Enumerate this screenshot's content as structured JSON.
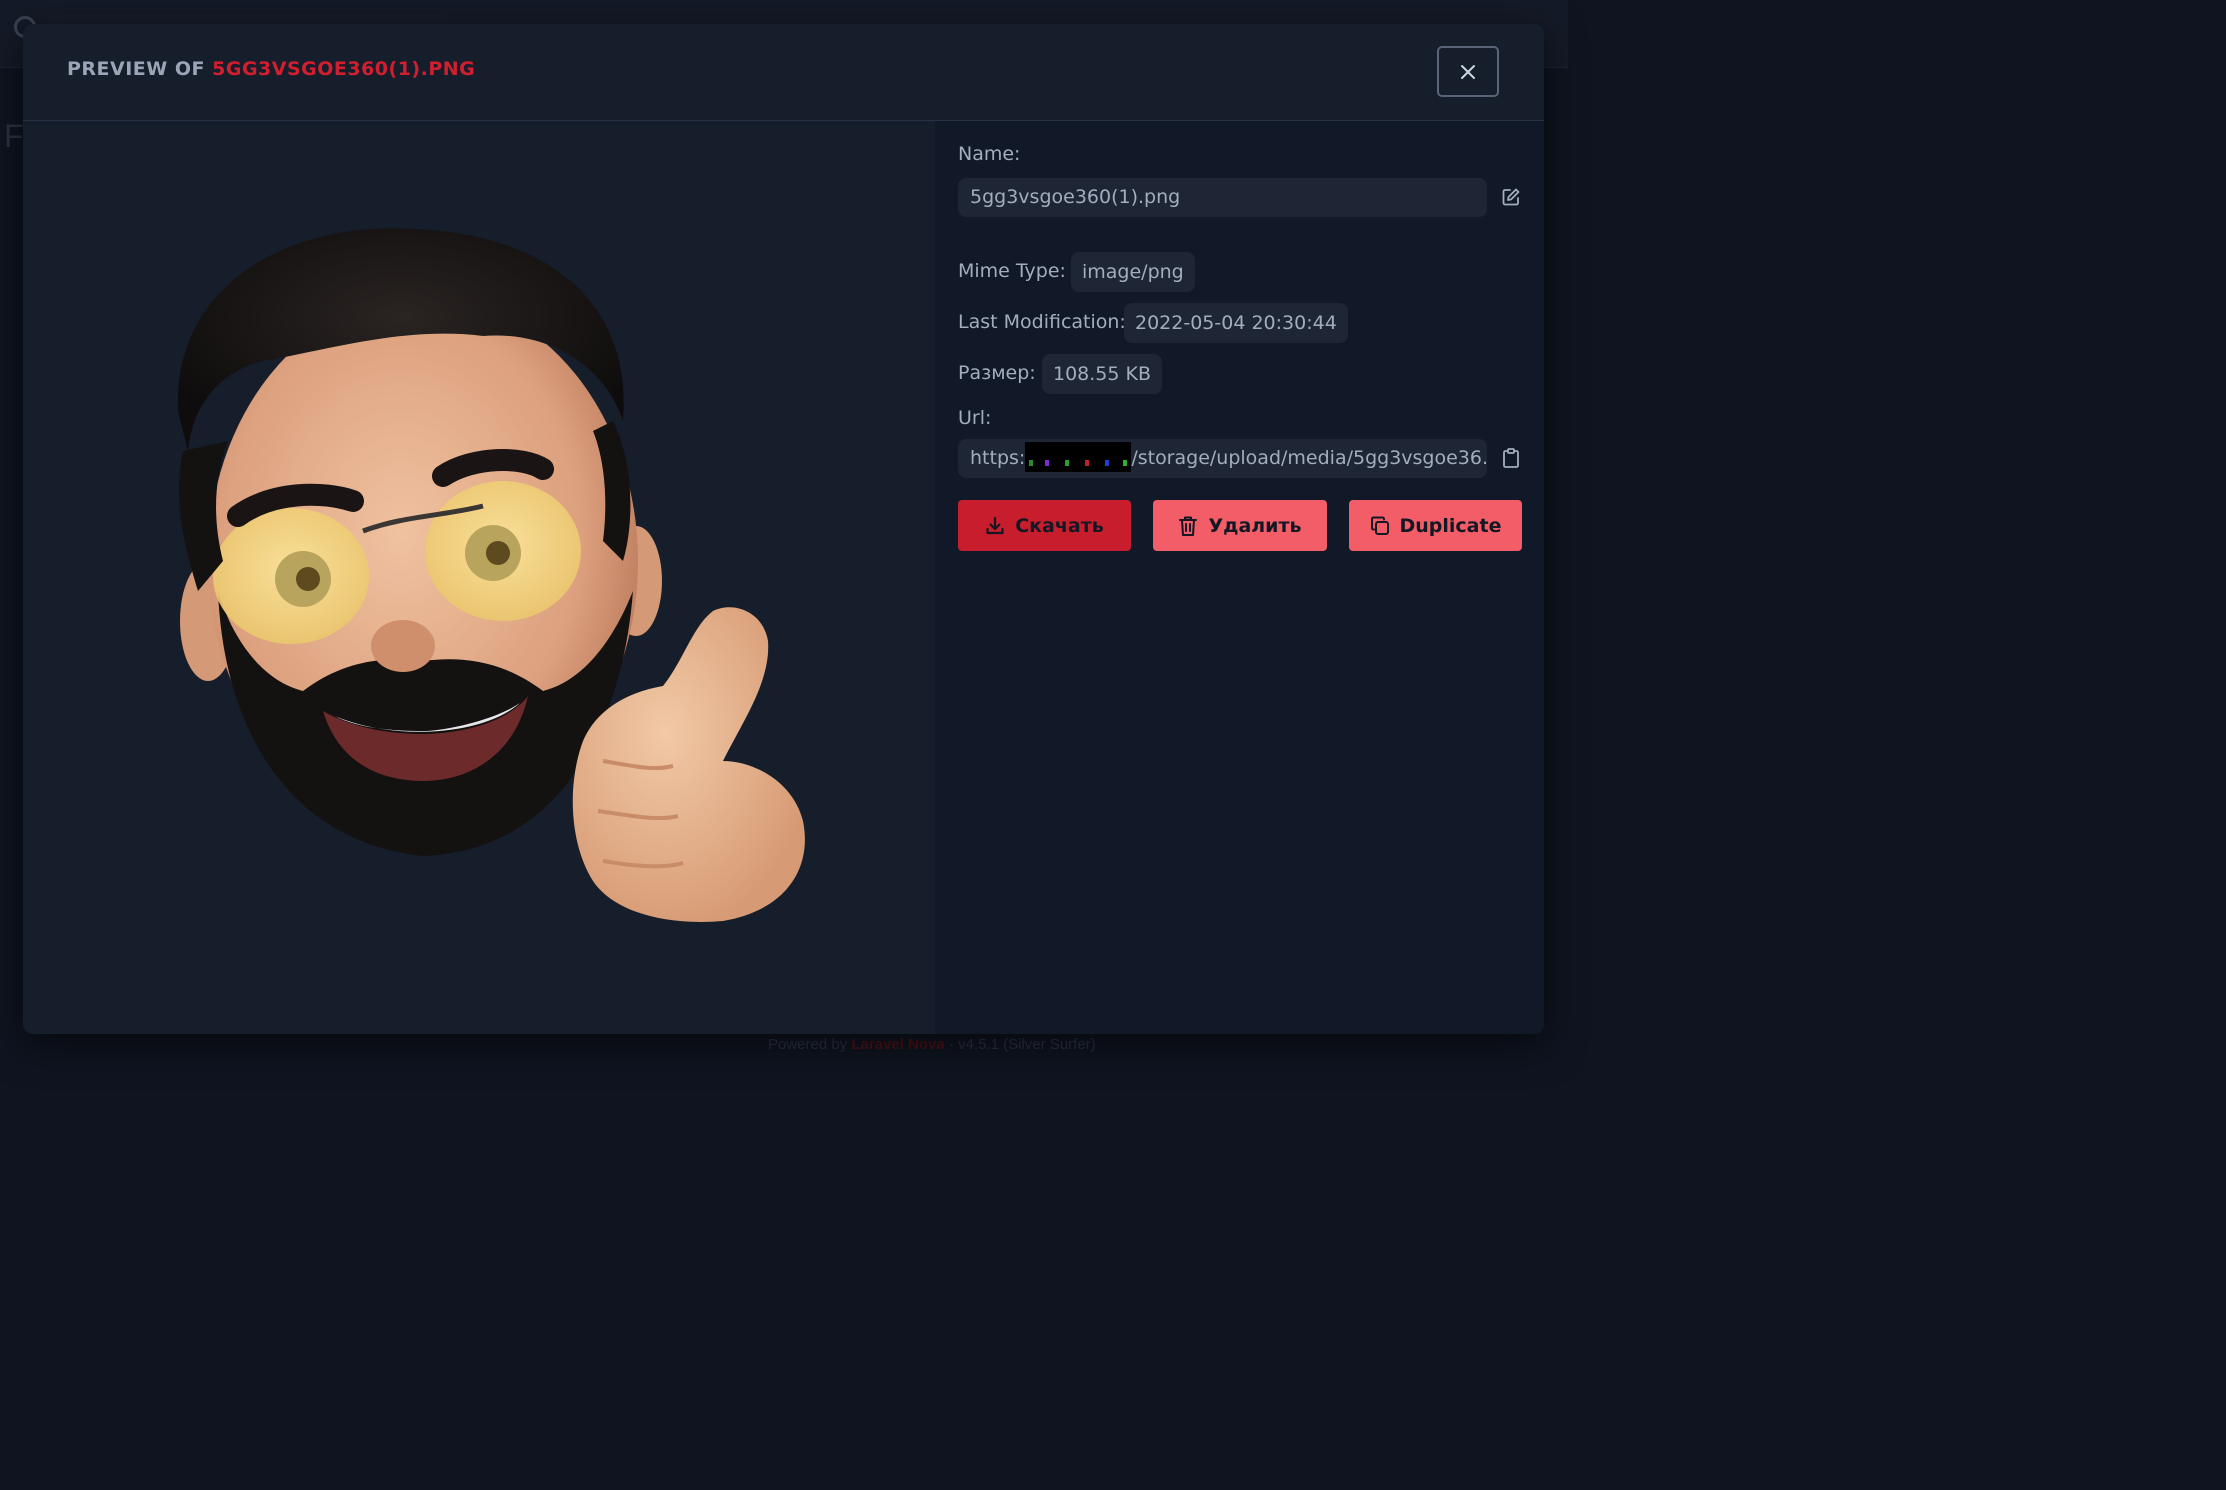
{
  "background": {
    "page_letter": "F",
    "footer": {
      "prefix": "Powered by",
      "brand": "Laravel Nova",
      "version": "· v4.5.1 (Silver Surfer)"
    }
  },
  "modal": {
    "title_prefix": "Preview of",
    "file_name_title": "5gg3vsgoe360(1).png",
    "close_icon": "close-icon",
    "preview": {
      "image_alt": "Memoji avatar: bearded man with sunglasses giving thumbs up"
    },
    "details": {
      "name_label": "Name:",
      "name_value": "5gg3vsgoe360(1).png",
      "mime_label": "Mime Type:",
      "mime_value": "image/png",
      "modified_label": "Last Modification:",
      "modified_value": "2022-05-04 20:30:44",
      "size_label": "Размер:",
      "size_value": "108.55 KB",
      "url_label": "Url:",
      "url_prefix": "https:",
      "url_suffix": "/storage/upload/media/5gg3vsgoe36..."
    },
    "actions": {
      "download_label": "Скачать",
      "delete_label": "Удалить",
      "duplicate_label": "Duplicate"
    }
  },
  "colors": {
    "accent_red": "#c81d2c",
    "accent_pink": "#f25d67",
    "title_filename": "#d21f30"
  }
}
